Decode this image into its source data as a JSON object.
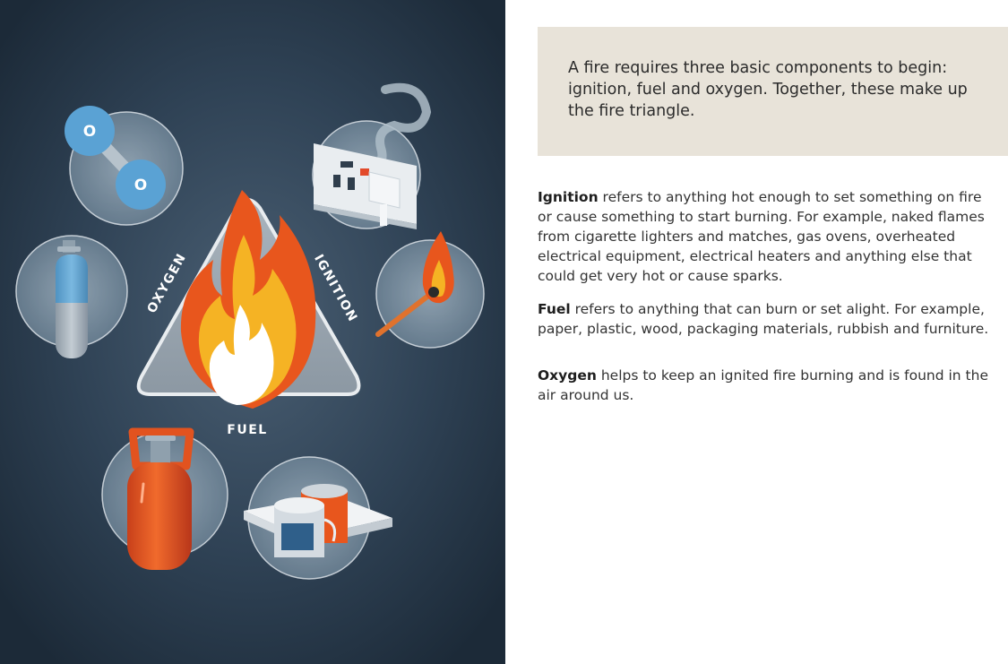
{
  "illustration": {
    "labels": {
      "oxygen": "OXYGEN",
      "ignition": "IGNITION",
      "fuel": "FUEL"
    },
    "molecule_atom": "O",
    "icons": [
      "oxygen-molecule-icon",
      "oxygen-cylinder-icon",
      "power-socket-icon",
      "lit-match-icon",
      "gas-cylinder-icon",
      "paper-and-paint-cans-icon",
      "flame-icon"
    ],
    "colors": {
      "background": "#2a3b4d",
      "flame_orange": "#e8561d",
      "flame_yellow": "#f5b324",
      "circle": "#8fa3b3",
      "cylinder_red": "#e2531f",
      "atom_blue": "#5aa2d4"
    }
  },
  "intro": {
    "text": "A fire requires three basic components to begin: ignition, fuel and oxygen. Together, these make up the fire triangle."
  },
  "paragraphs": {
    "ignition": {
      "term": "Ignition",
      "text": " refers to anything hot enough to set something on fire or cause something to start burning. For example, naked flames from cigarette lighters and matches, gas ovens, overheated electrical equipment, electrical heaters and anything else that could get very hot or cause sparks."
    },
    "fuel": {
      "term": "Fuel",
      "text": " refers to anything that can burn or set alight. For example, paper, plastic, wood, packaging materials, rubbish and furniture."
    },
    "oxygen": {
      "term": "Oxygen",
      "text": " helps to keep an ignited fire burning and is found in the air around us."
    }
  }
}
